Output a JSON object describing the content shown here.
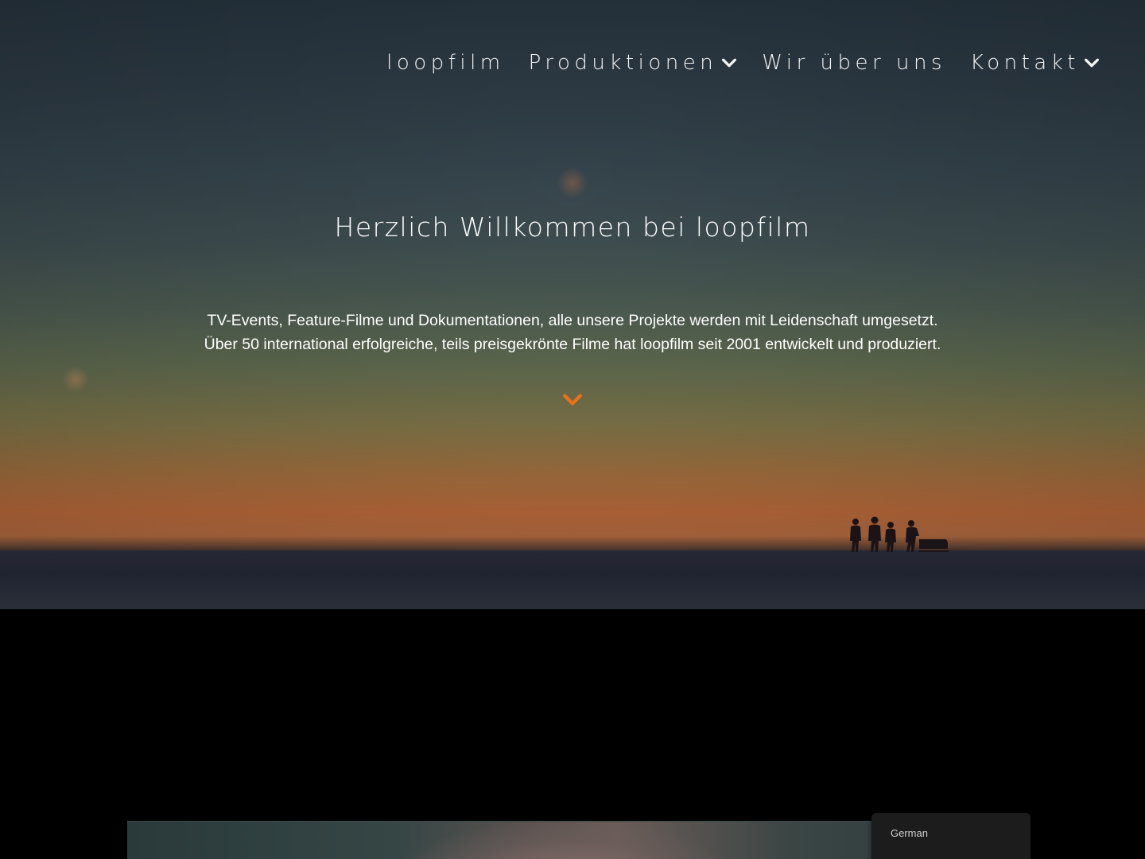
{
  "nav": {
    "items": [
      {
        "label": "loopfilm",
        "has_dropdown": false
      },
      {
        "label": "Produktionen",
        "has_dropdown": true
      },
      {
        "label": "Wir über uns",
        "has_dropdown": false
      },
      {
        "label": "Kontakt",
        "has_dropdown": true
      }
    ]
  },
  "hero": {
    "title": "Herzlich Willkommen bei loopfilm",
    "text_line1": "TV-Events, Feature-Filme und Dokumentationen, alle unsere Projekte werden mit Leidenschaft umgesetzt.",
    "text_line2": "Über 50 international erfolgreiche, teils preisgekrönte Filme hat loopfilm seit 2001 entwickelt und produziert.",
    "scroll_icon": "chevron-down-icon"
  },
  "language_switcher": {
    "selected": "German"
  },
  "colors": {
    "accent": "#e8721c",
    "text": "#ffffff",
    "page_background": "#000000"
  }
}
